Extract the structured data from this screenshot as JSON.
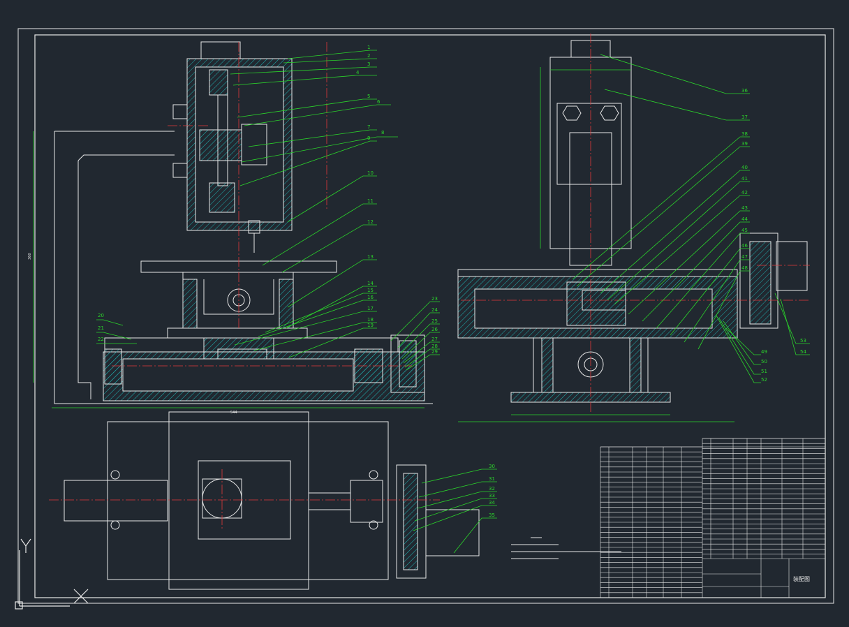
{
  "drawing": {
    "part_numbers_left": [
      "1",
      "2",
      "3",
      "4",
      "5",
      "6",
      "7",
      "8",
      "9",
      "10",
      "11",
      "12",
      "13",
      "14",
      "15",
      "16",
      "17",
      "18",
      "19",
      "20",
      "21",
      "22",
      "23",
      "24",
      "25",
      "26",
      "27",
      "28",
      "29"
    ],
    "part_numbers_right": [
      "36",
      "37",
      "38",
      "39",
      "40",
      "41",
      "42",
      "43",
      "44",
      "45",
      "46",
      "47",
      "48",
      "49",
      "50",
      "51",
      "52",
      "53",
      "54"
    ],
    "part_numbers_plan": [
      "30",
      "31",
      "32",
      "33",
      "34",
      "35"
    ],
    "dimension_overall_width": "544",
    "dimension_overall_height": "360",
    "title_block_name": "装配图",
    "colors": {
      "background": "#212830",
      "outline": "#e8e8e8",
      "leader": "#2bd42b",
      "hatch": "#1fb3b3",
      "centerline": "#e23a3a"
    }
  },
  "ui": {
    "axis_y_label": "Y",
    "icons": [
      "ucs-icon",
      "crosshair-icon"
    ]
  }
}
